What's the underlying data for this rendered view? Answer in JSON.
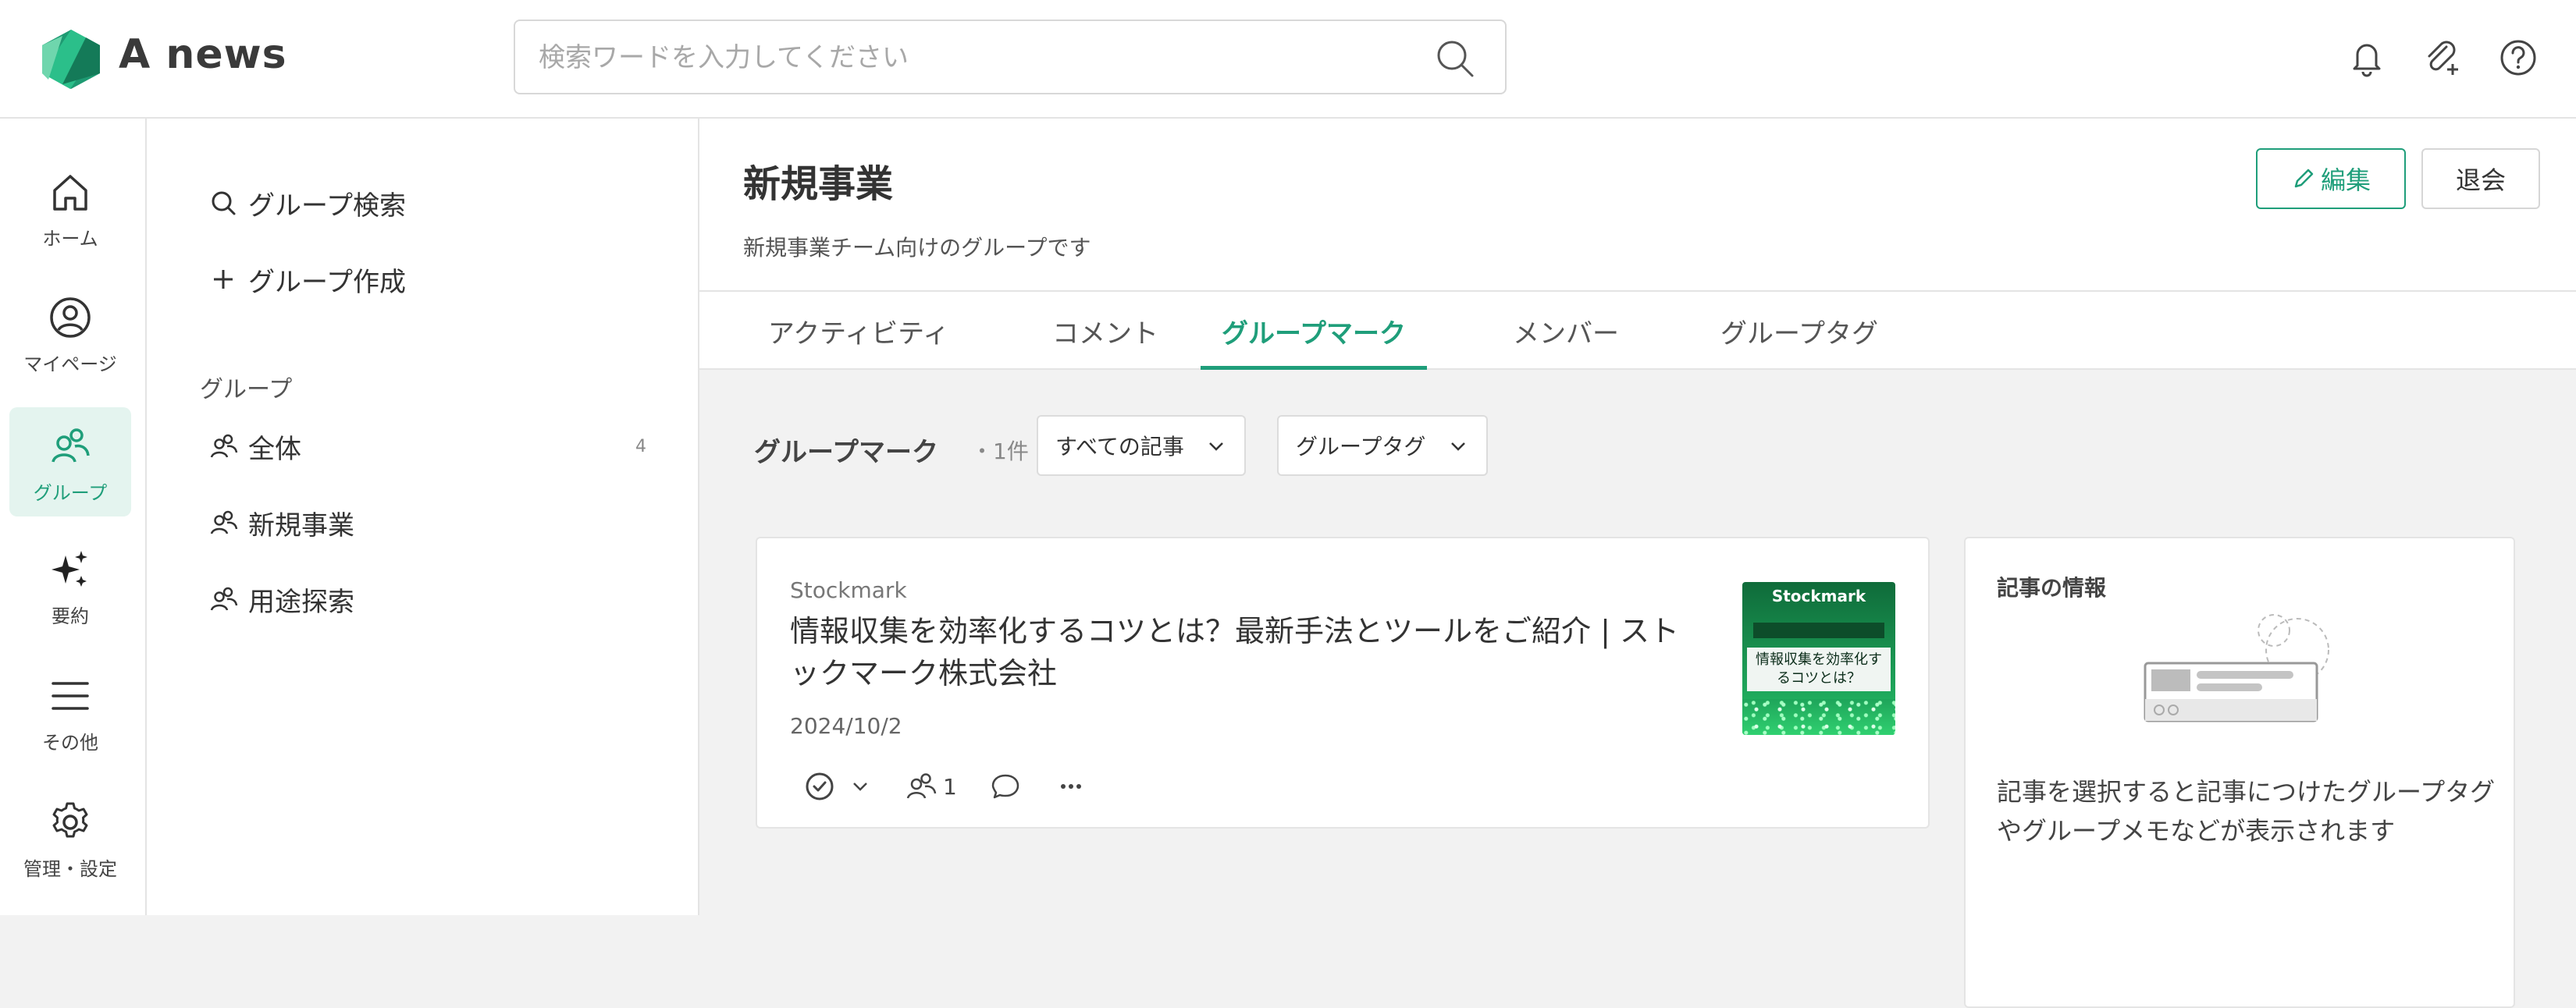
{
  "header": {
    "app_name": "A news",
    "search_placeholder": "検索ワードを入力してください",
    "icons": [
      "bell-icon",
      "clip-icon",
      "help-icon"
    ]
  },
  "rail": {
    "items": [
      {
        "label": "ホーム",
        "icon": "home-icon"
      },
      {
        "label": "マイページ",
        "icon": "user-icon"
      },
      {
        "label": "グループ",
        "icon": "group-icon",
        "active": true
      },
      {
        "label": "要約",
        "icon": "sparkle-icon"
      },
      {
        "label": "その他",
        "icon": "menu-icon"
      },
      {
        "label": "管理・設定",
        "icon": "gear-icon"
      }
    ]
  },
  "group_sidebar": {
    "search_label": "グループ検索",
    "create_label": "グループ作成",
    "section_heading": "グループ",
    "groups": [
      {
        "name": "全体",
        "count": "4"
      },
      {
        "name": "新規事業"
      },
      {
        "name": "用途探索"
      }
    ]
  },
  "group": {
    "title": "新規事業",
    "description": "新規事業チーム向けのグループです",
    "edit_label": "編集",
    "leave_label": "退会"
  },
  "tabs": [
    {
      "label": "アクティビティ"
    },
    {
      "label": "コメント"
    },
    {
      "label": "グループマーク",
      "active": true
    },
    {
      "label": "メンバー"
    },
    {
      "label": "グループタグ"
    }
  ],
  "toolbar": {
    "title": "グループマーク",
    "count": "・1件",
    "filter_all": "すべての記事",
    "filter_tag": "グループタグ"
  },
  "article": {
    "source": "Stockmark",
    "title": "情報収集を効率化するコツとは？最新手法とツールをご紹介 | ストックマーク株式会社",
    "date": "2024/10/2",
    "mark_count": "1",
    "thumbnail": {
      "brand": "Stockmark",
      "headline": "情報収集を効率化するコツとは？"
    }
  },
  "info_panel": {
    "title": "記事の情報",
    "message": "記事を選択すると記事につけたグループタグやグループメモなどが表示されます"
  },
  "colors": {
    "accent": "#1f9e7a",
    "active_bg": "#e4f4ef",
    "page_bg": "#f2f2f2"
  }
}
